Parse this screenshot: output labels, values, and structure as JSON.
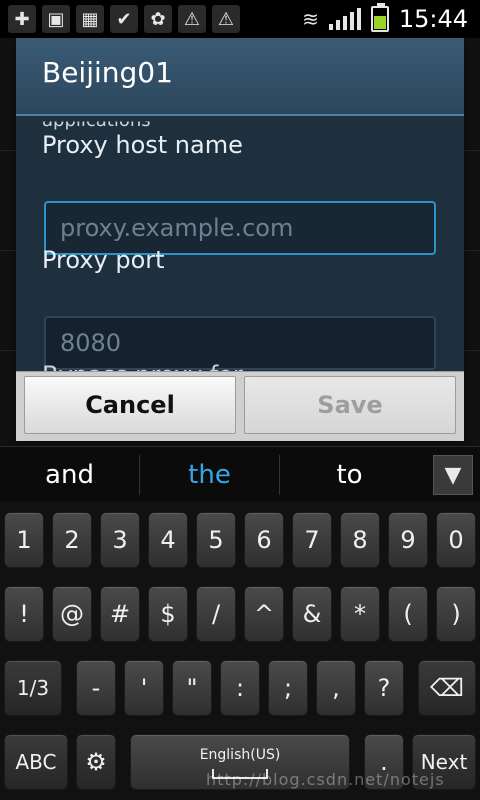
{
  "status_bar": {
    "icons": [
      "plus-box-icon",
      "image-icon",
      "calendar-icon",
      "phone-check-icon",
      "butterfly-icon",
      "warning-icon",
      "warning-icon"
    ],
    "time": "15:44",
    "battery_level": 0.6
  },
  "dialog": {
    "title": "Beijing01",
    "cut_text_top": "applications",
    "fields": [
      {
        "label": "Proxy host name",
        "placeholder": "proxy.example.com",
        "focused": true
      },
      {
        "label": "Proxy port",
        "placeholder": "8080",
        "focused": false
      }
    ],
    "cut_text_bottom": "Bypass proxy for",
    "buttons": {
      "cancel": "Cancel",
      "save": "Save"
    }
  },
  "suggestions": {
    "items": [
      "and",
      "the",
      "to"
    ],
    "toggle_icon": "chevron-down-icon"
  },
  "keyboard": {
    "rows": [
      [
        "1",
        "2",
        "3",
        "4",
        "5",
        "6",
        "7",
        "8",
        "9",
        "0"
      ],
      [
        "!",
        "@",
        "#",
        "$",
        "/",
        "^",
        "&",
        "*",
        "(",
        ")"
      ],
      [
        "1/3",
        "-",
        "'",
        "\"",
        ":",
        ";",
        ",",
        "?"
      ]
    ],
    "backspace_icon": "backspace-icon",
    "abc": "ABC",
    "settings_icon": "gear-icon",
    "space_label": "English(US)",
    "period": ".",
    "next": "Next"
  },
  "watermark": "http://blog.csdn.net/notejs"
}
